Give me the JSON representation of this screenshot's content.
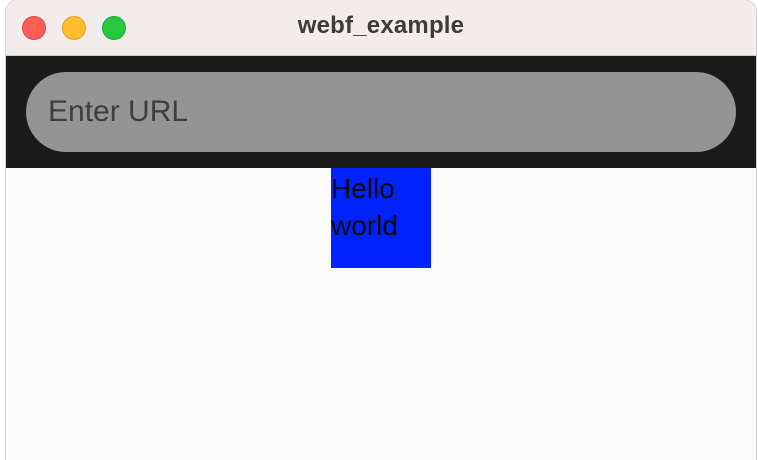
{
  "window": {
    "title": "webf_example",
    "controls": [
      "close",
      "minimize",
      "zoom"
    ]
  },
  "appbar": {
    "url_input": {
      "value": "",
      "placeholder": "Enter URL"
    }
  },
  "content": {
    "box_text": "Hello world",
    "box_color": "#0022ff"
  },
  "colors": {
    "titlebar": "#f2ecec",
    "appbar": "#1b1b1b",
    "input": "#949494",
    "close": "#ff5f57",
    "minimize": "#febc2e",
    "zoom": "#28c840"
  }
}
